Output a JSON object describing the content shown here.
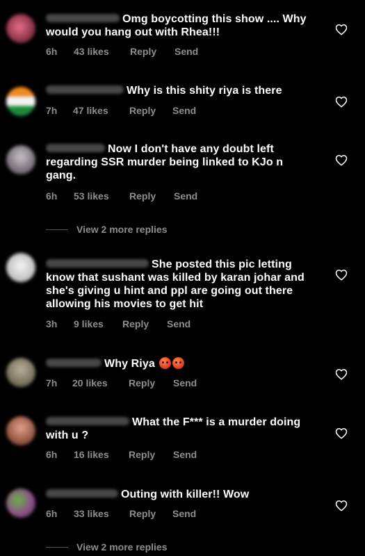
{
  "comments": [
    {
      "text": "Omg boycotting this show .... Why would you hang out with Rhea!!!",
      "time": "6h",
      "likes": "43 likes",
      "reply": "Reply",
      "send": "Send"
    },
    {
      "text": "Why is this shity riya is there",
      "time": "7h",
      "likes": "47 likes",
      "reply": "Reply",
      "send": "Send"
    },
    {
      "text": "Now I don't have any doubt left regarding SSR murder being linked to KJo n gang.",
      "time": "6h",
      "likes": "53 likes",
      "reply": "Reply",
      "send": "Send",
      "view_more": "View 2 more replies"
    },
    {
      "text": "She posted this pic letting know that sushant was killed by karan johar and she's giving u hint and ppl are going out there allowing his movies to get hit",
      "time": "3h",
      "likes": "9 likes",
      "reply": "Reply",
      "send": "Send"
    },
    {
      "text": "Why Riya",
      "emojis": [
        "angry-face-emoji",
        "angry-face-emoji"
      ],
      "time": "7h",
      "likes": "20 likes",
      "reply": "Reply",
      "send": "Send"
    },
    {
      "text": "What the F*** is a murder doing with u ?",
      "time": "6h",
      "likes": "16 likes",
      "reply": "Reply",
      "send": "Send"
    },
    {
      "text": "Outing with killer!! Wow",
      "time": "6h",
      "likes": "33 likes",
      "reply": "Reply",
      "send": "Send",
      "view_more": "View 2 more replies"
    }
  ],
  "icons": {
    "like": "heart-outline-icon"
  },
  "colors": {
    "background": "#000000",
    "text": "#ffffff",
    "meta": "#8e8e8e"
  }
}
